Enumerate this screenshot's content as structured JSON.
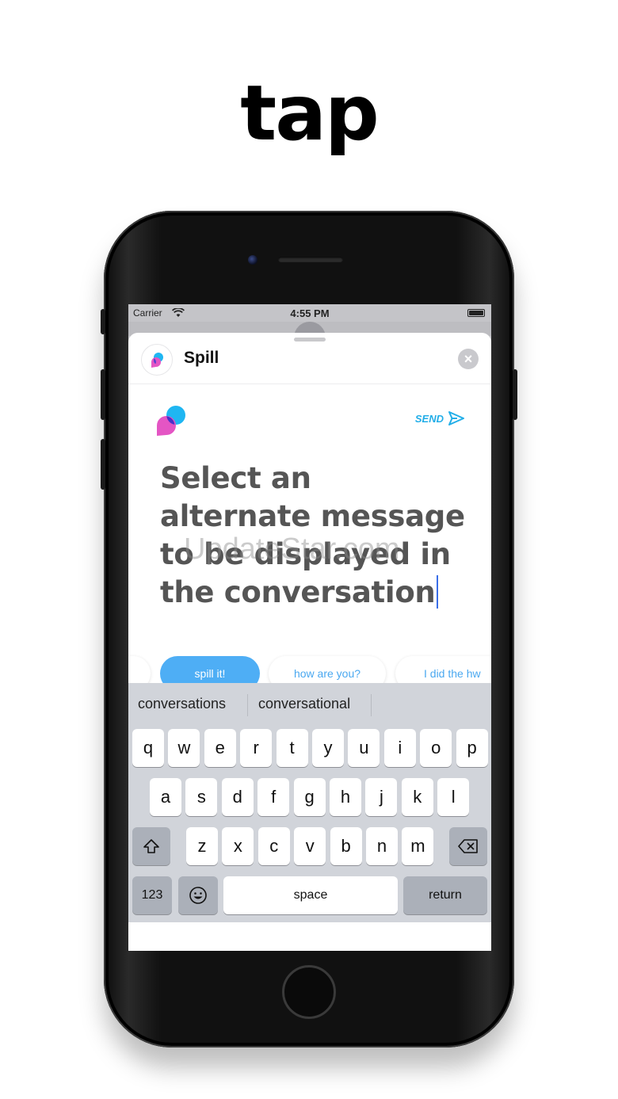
{
  "headline": "tap",
  "status_bar": {
    "carrier": "Carrier",
    "time": "4:55 PM"
  },
  "sheet": {
    "app_title": "Spill",
    "close_glyph": "×"
  },
  "compose": {
    "send_label": "SEND",
    "message_text": "Select an alternate message to be displayed in the conversation",
    "watermark": "UpdateStar.com"
  },
  "suggestions": [
    "spill it!",
    "how are you?",
    "I did the hw"
  ],
  "keyboard": {
    "predictions": [
      "conversations",
      "conversational"
    ],
    "row1": [
      "q",
      "w",
      "e",
      "r",
      "t",
      "y",
      "u",
      "i",
      "o",
      "p"
    ],
    "row2": [
      "a",
      "s",
      "d",
      "f",
      "g",
      "h",
      "j",
      "k",
      "l"
    ],
    "row3": [
      "z",
      "x",
      "c",
      "v",
      "b",
      "n",
      "m"
    ],
    "numbers_label": "123",
    "space_label": "space",
    "return_label": "return"
  },
  "colors": {
    "accent": "#22aee8",
    "chip_primary": "#4eaef5",
    "logo_pink": "#e455c4",
    "logo_blue": "#1fb6f2"
  },
  "icons": {
    "wifi": "wifi-icon",
    "battery": "battery-icon",
    "send": "send-arrow-icon",
    "shift": "shift-icon",
    "delete": "backspace-icon",
    "emoji": "emoji-icon"
  }
}
